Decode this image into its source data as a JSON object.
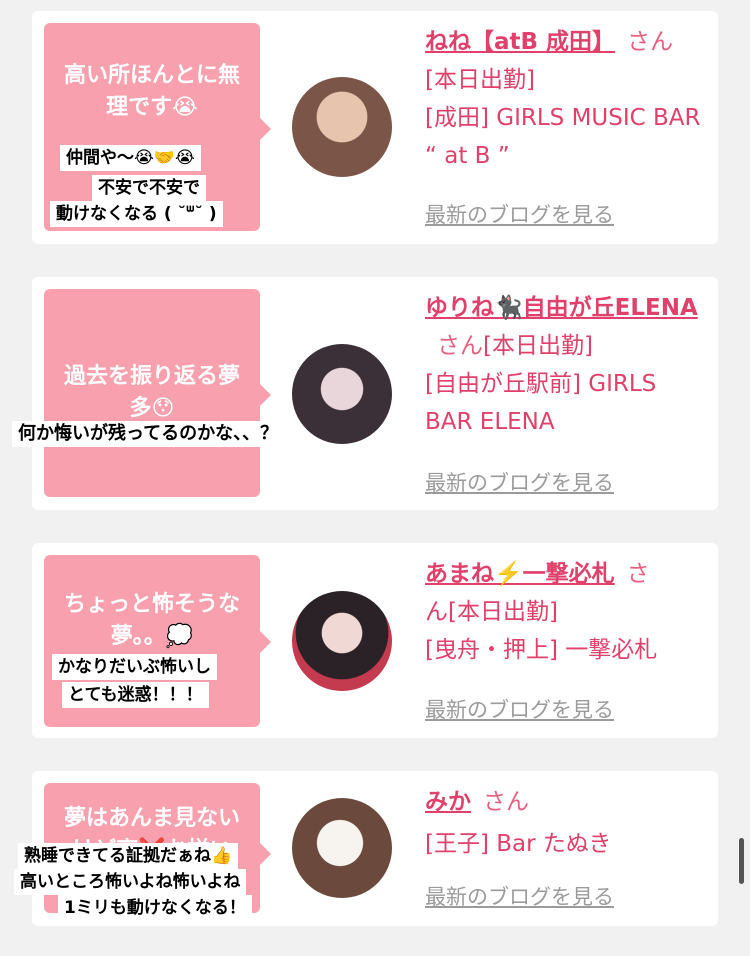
{
  "cards": [
    {
      "bubble": "高い所ほんとに無理です😭",
      "name": "ねね【atB 成田】",
      "san": "さん",
      "status": "[本日出勤]",
      "shop": "[成田] GIRLS MUSIC BAR “ at B ”",
      "blog": "最新のブログを見る",
      "overlay_lines": [
        "仲間や〜😭🤝😭",
        "不安で不安で",
        "動けなくなる (  ˘ᐜ˘  )"
      ],
      "avatar_colors": [
        "#7a5548",
        "#d9b39a"
      ]
    },
    {
      "bubble": "過去を振り返る夢多😯",
      "name": "ゆりね🐈‍⬛自由が丘ELENA",
      "san": "さん",
      "status": "[本日出勤]",
      "shop": "[自由が丘駅前] GIRLS BAR ELENA",
      "blog": "最新のブログを見る",
      "overlay_lines": [
        "何か悔いが残ってるのかな、、？"
      ],
      "avatar_colors": [
        "#3b3037",
        "#d8c6cc"
      ]
    },
    {
      "bubble": "ちょっと怖そうな夢。。💭",
      "name": "あまね⚡️一撃必札",
      "san": "さ",
      "status": "ん[本日出勤]",
      "shop": "[曳舟・押上] 一撃必札",
      "blog": "最新のブログを見る",
      "overlay_lines": [
        "かなりだいぶ怖いし",
        "とても迷惑！！！"
      ],
      "avatar_colors": [
        "#c43a4f",
        "#2a2226"
      ]
    },
    {
      "bubble": "夢はあんま見ないけど高❌お揃い",
      "name": "みか",
      "san": "さん",
      "status": "",
      "shop": "[王子] Bar たぬき",
      "blog": "最新のブログを見る",
      "overlay_lines": [
        "熟睡できてる証拠だぁね👍",
        "高いところ怖いよね怖いよね",
        "1ミリも動けなくなる！"
      ],
      "avatar_colors": [
        "#6b4a3d",
        "#f2ede8"
      ]
    }
  ]
}
